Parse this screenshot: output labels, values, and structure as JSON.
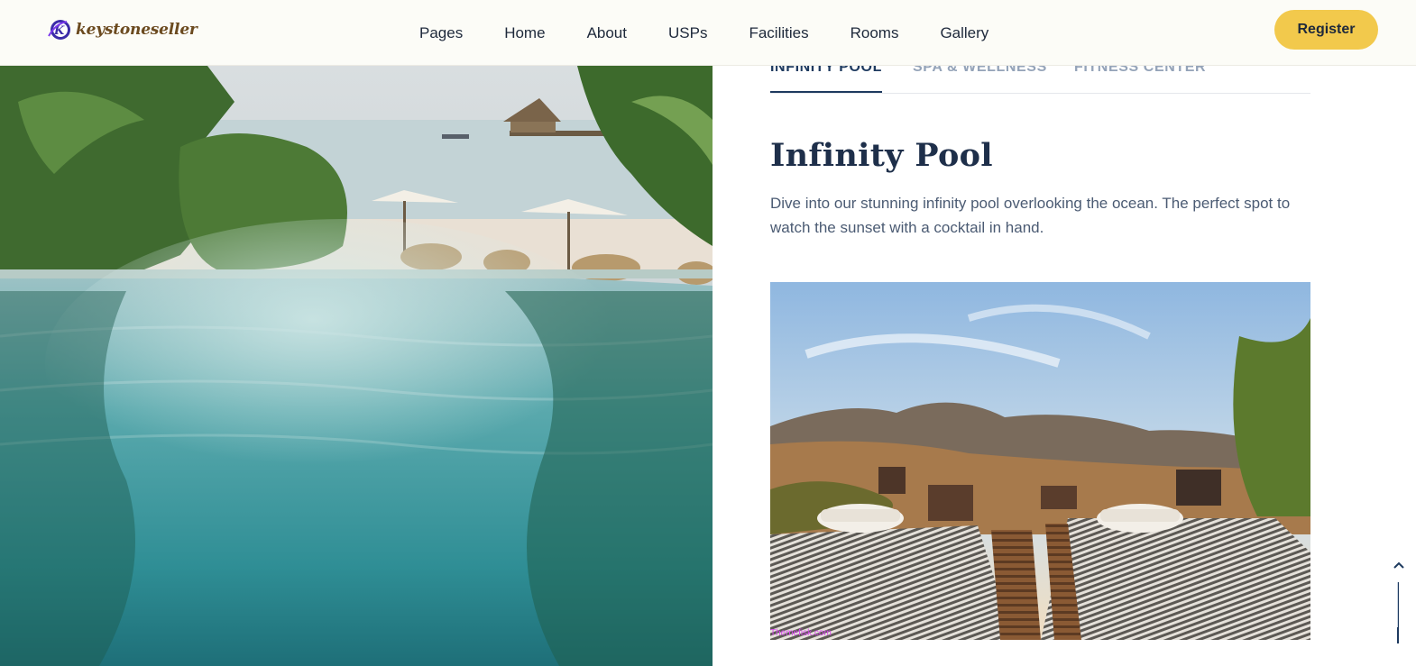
{
  "brand": {
    "name": "keystoneseller",
    "logo_icon": "kr-monogram-icon"
  },
  "nav": {
    "items": [
      {
        "label": "Pages"
      },
      {
        "label": "Home"
      },
      {
        "label": "About"
      },
      {
        "label": "USPs"
      },
      {
        "label": "Facilities"
      },
      {
        "label": "Rooms"
      },
      {
        "label": "Gallery"
      }
    ],
    "register_label": "Register"
  },
  "facility_tabs": [
    {
      "label": "INFINITY POOL",
      "active": true
    },
    {
      "label": "SPA & WELLNESS",
      "active": false
    },
    {
      "label": "FITNESS CENTER",
      "active": false
    }
  ],
  "section": {
    "title": "Infinity Pool",
    "description": "Dive into our stunning infinity pool overlooking the ocean. The perfect spot to watch the sunset with a cocktail in hand."
  },
  "feature_image": {
    "watermark": "Themefisk.com"
  },
  "colors": {
    "accent": "#f2c94c",
    "heading": "#1e2f4a",
    "active_tab": "#1e3a5f",
    "inactive_tab": "#94a3b8"
  },
  "icons": {
    "scroll_top": "chevron-up-icon"
  }
}
